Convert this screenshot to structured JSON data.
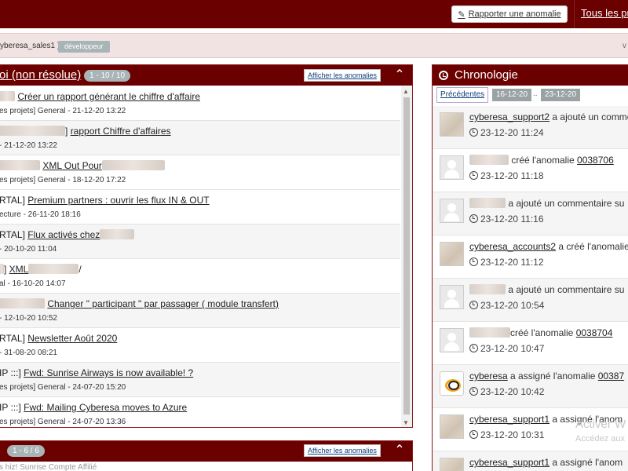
{
  "topbar": {
    "report_label": "Rapporter une anomalie",
    "all_projects_label": "Tous les pr"
  },
  "strip": {
    "user_text": "yberesa_sales1 )",
    "role": "développeur",
    "right_text": "v"
  },
  "assigned_panel": {
    "title": "oi (non résolue)",
    "count": "1 - 10 / 10",
    "show_label": "Afficher les anomalies",
    "rows": [
      {
        "title_prefix": "",
        "link": "Créer un rapport générant le chiffre d'affaire",
        "meta": "es projets] General - 21-12-20 13:22"
      },
      {
        "title_prefix": "]",
        "link": "rapport Chiffre d'affaires",
        "meta": "- 21-12-20 13:22"
      },
      {
        "title_prefix": "",
        "link": "XML Out Pour",
        "meta": "es projets] General - 18-12-20 17:22"
      },
      {
        "title_prefix": "RTAL]",
        "link": "Premium partners : ouvrir les flux IN & OUT",
        "meta": "ecture - 26-11-20 18:16"
      },
      {
        "title_prefix": "RTAL]",
        "link": "Flux activés chez",
        "meta": "- 20-10-20 11:04"
      },
      {
        "title_prefix": "",
        "link": "XML",
        "meta": "al - 16-10-20 14:07"
      },
      {
        "title_prefix": "",
        "link": "Changer \" participant \" par passager ( module transfert)",
        "meta": "- 12-10-20 10:52"
      },
      {
        "title_prefix": "RTAL]",
        "link": "Newsletter Août 2020",
        "meta": "- 31-08-20 08:21"
      },
      {
        "title_prefix": "IP :::]",
        "link": "Fwd: Sunrise Airways is now available! ?",
        "meta": "es projets] General - 24-07-20 15:20"
      },
      {
        "title_prefix": "IP :::]",
        "link": "Fwd: Mailing Cyberesa moves to Azure",
        "meta": "es projets] General - 24-07-20 13:36"
      }
    ]
  },
  "second_panel": {
    "count": "1 - 6 / 6",
    "show_label": "Afficher les anomalies",
    "peek_text": "s hiz! Sunrise  Compte Affilié"
  },
  "chronology": {
    "title": "Chronologie",
    "prev_label": "Précédentes",
    "date_from": "16-12-20",
    "dots": "..",
    "date_to": "23-12-20",
    "events": [
      {
        "avatar": "photo",
        "user": "cyberesa_support2",
        "action": "a ajouté un comme",
        "ref": "",
        "time": "23-12-20 11:24"
      },
      {
        "avatar": "default",
        "user": "",
        "action": "créé l'anomalie",
        "ref": "0038706",
        "time": "23-12-20 11:18"
      },
      {
        "avatar": "default",
        "user": "",
        "action": "a ajouté un commentaire su",
        "ref": "",
        "time": "23-12-20 11:16"
      },
      {
        "avatar": "photo",
        "user": "cyberesa_accounts2",
        "action": "a créé l'anomalie",
        "ref": "",
        "time": "23-12-20 11:12"
      },
      {
        "avatar": "default",
        "user": "",
        "action": "a ajouté un commentaire su",
        "ref": "",
        "time": "23-12-20 10:54"
      },
      {
        "avatar": "default",
        "user": "",
        "action": "créé l'anomalie",
        "ref": "0038704",
        "time": "23-12-20 10:47"
      },
      {
        "avatar": "logo",
        "user": "cyberesa",
        "action": "a assigné l'anomalie",
        "ref": "00387",
        "time": "23-12-20 10:42"
      },
      {
        "avatar": "photo",
        "user": "cyberesa_support1",
        "action": "a assigné l'anom",
        "ref": "",
        "time": "23-12-20 10:31"
      },
      {
        "avatar": "photo",
        "user": "cyberesa_support1",
        "action": "a assigné l'anom",
        "ref": "",
        "time": ""
      }
    ]
  },
  "watermark": {
    "line1": "Activer W",
    "line2": "Accédez aux"
  }
}
